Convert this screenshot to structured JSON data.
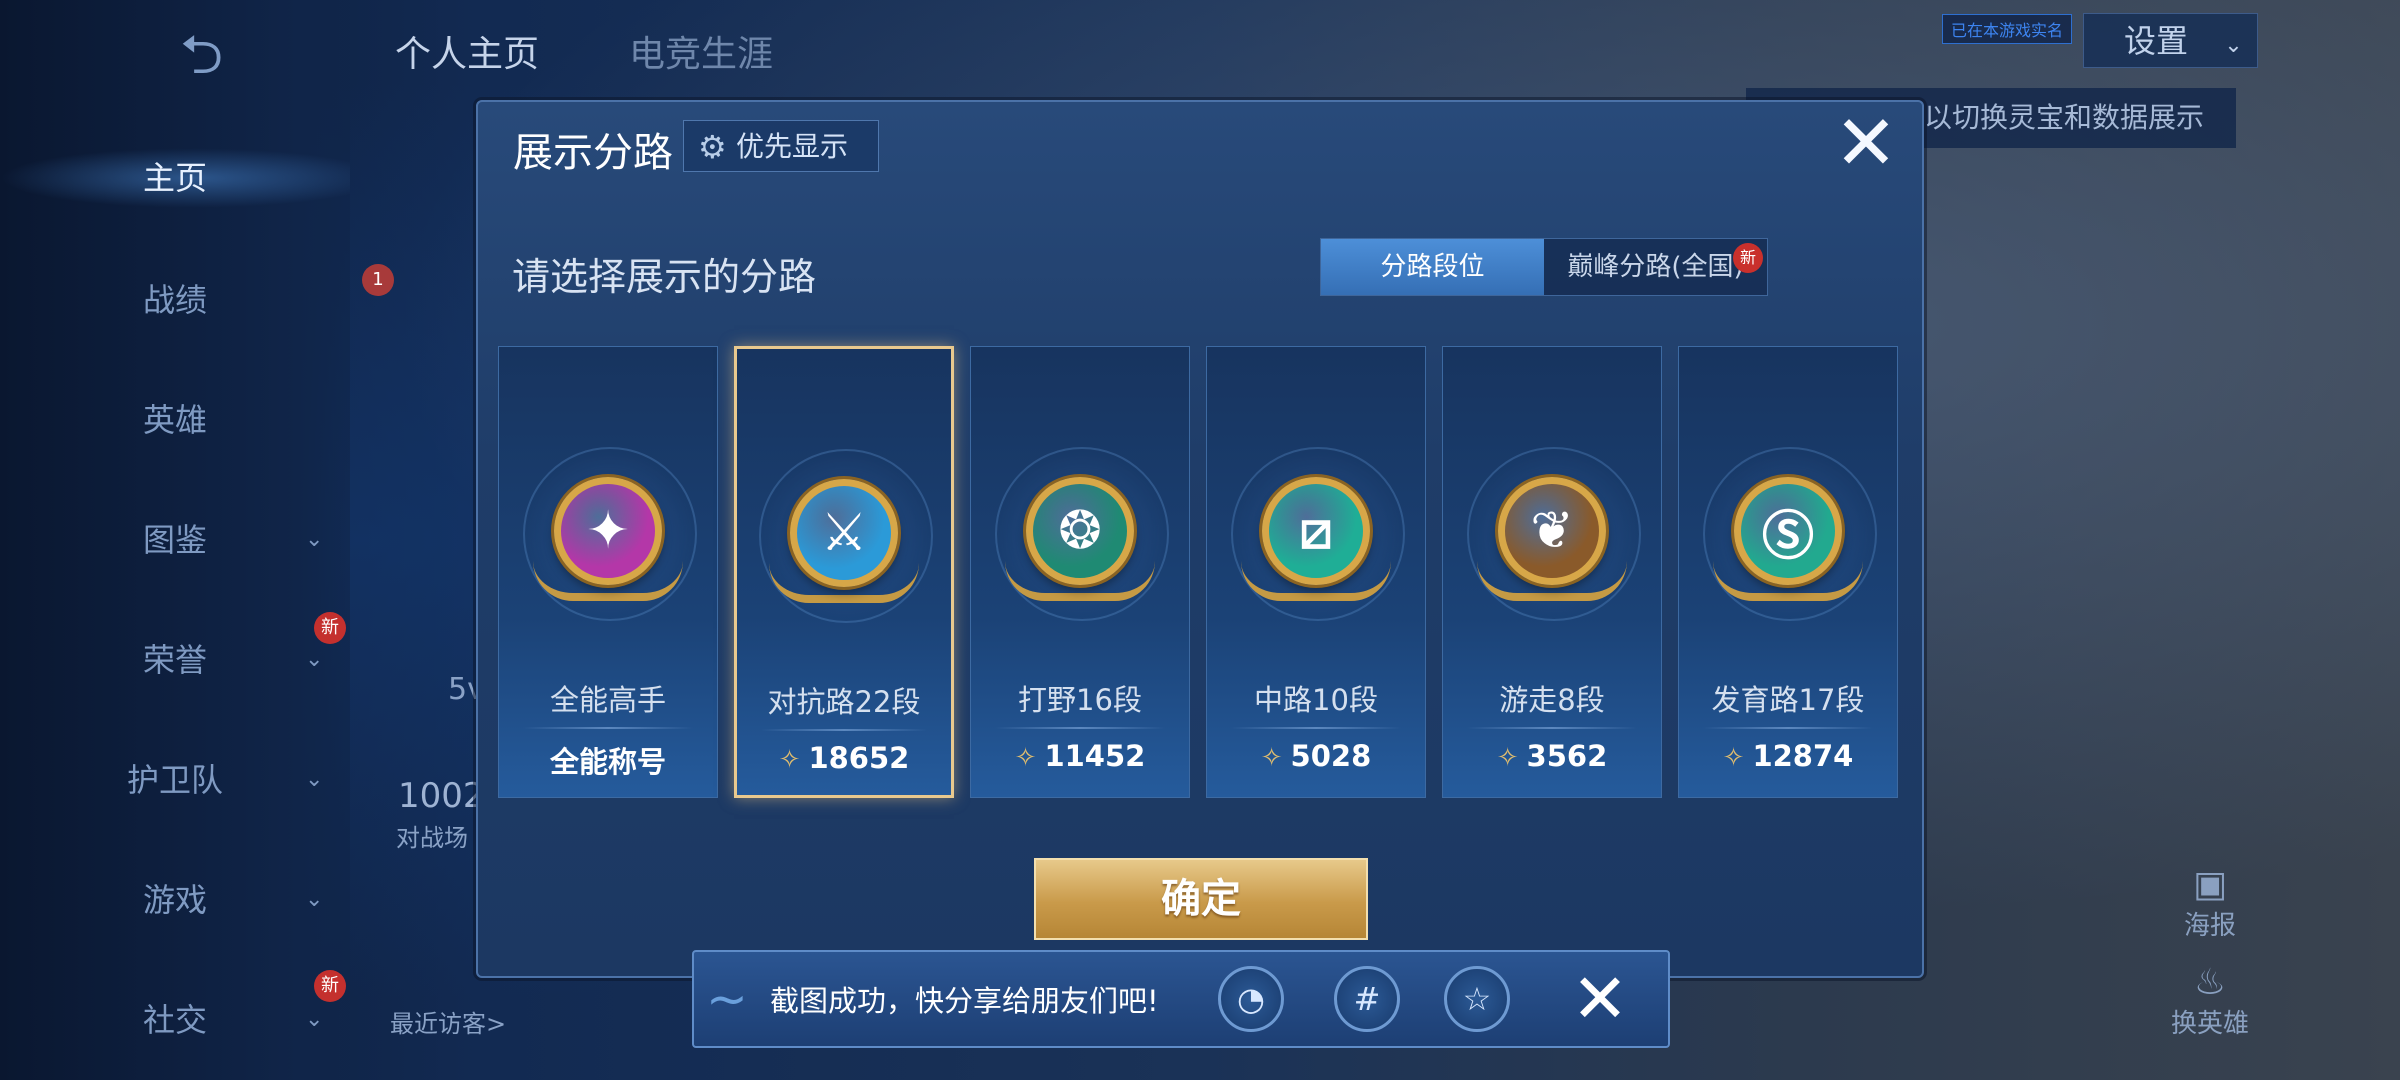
{
  "background": {
    "back_icon": "back-arrow-icon",
    "nav_items": [
      {
        "label": "主页",
        "active": true
      },
      {
        "label": "战绩"
      },
      {
        "label": "英雄"
      },
      {
        "label": "图鉴",
        "chevron": true
      },
      {
        "label": "荣誉",
        "chevron": true,
        "new": "新"
      },
      {
        "label": "护卫队",
        "chevron": true
      },
      {
        "label": "游戏",
        "chevron": true
      },
      {
        "label": "社交",
        "chevron": true,
        "new": "新"
      }
    ],
    "top_tabs": [
      "个人主页",
      "电竞生涯"
    ],
    "settings_label": "设置",
    "realname_tag": "已在本游戏实名",
    "hint_text": "以切换灵宝和数据展示",
    "poster_label": "海报",
    "change_hero_label": "换英雄",
    "visitors_label": "最近访客>",
    "stat_number": "1002",
    "stat_label": "对战场",
    "level_badge": "1",
    "mode_label": "5v"
  },
  "modal": {
    "title": "展示分路",
    "priority_label": "优先显示",
    "close_icon": "close-icon",
    "subtitle": "请选择展示的分路",
    "toggle": {
      "option1": "分路段位",
      "option2": "巅峰分路(全国)",
      "new_badge": "新"
    },
    "cards": [
      {
        "name": "全能高手",
        "score": "全能称号",
        "emblem_color": "#b437a8",
        "symbol": "✦",
        "has_score_icon": false,
        "selected": false
      },
      {
        "name": "对抗路22段",
        "score": "18652",
        "emblem_color": "#2b9ad8",
        "symbol": "⚔",
        "has_score_icon": true,
        "selected": true
      },
      {
        "name": "打野16段",
        "score": "11452",
        "emblem_color": "#1f8a73",
        "symbol": "❂",
        "has_score_icon": true,
        "selected": false
      },
      {
        "name": "中路10段",
        "score": "5028",
        "emblem_color": "#1fae96",
        "symbol": "⧄",
        "has_score_icon": true,
        "selected": false
      },
      {
        "name": "游走8段",
        "score": "3562",
        "emblem_color": "#8a5a2a",
        "symbol": "❦",
        "has_score_icon": true,
        "selected": false
      },
      {
        "name": "发育路17段",
        "score": "12874",
        "emblem_color": "#22a98f",
        "symbol": "Ⓢ",
        "has_score_icon": true,
        "selected": false
      }
    ],
    "confirm_label": "确定"
  },
  "share_bar": {
    "text": "截图成功，快分享给朋友们吧!",
    "icons": [
      "qq-icon",
      "wechat-moments-icon",
      "qzone-icon"
    ],
    "icon_glyphs": [
      "◔",
      "#",
      "☆"
    ],
    "close_icon": "close-icon"
  }
}
